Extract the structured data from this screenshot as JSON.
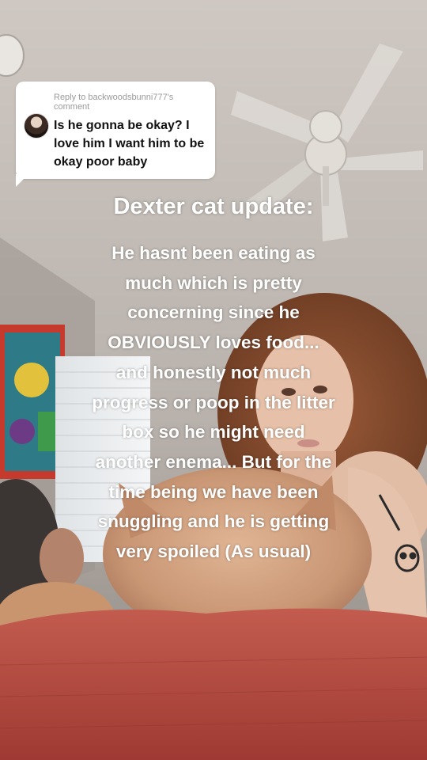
{
  "reply": {
    "meta": "Reply to backwoodsbunni777's comment",
    "comment": "Is he gonna be okay? I love him I want him to be okay poor baby"
  },
  "title": "Dexter cat update:",
  "body": "He hasnt been eating as\nmuch which is pretty\nconcerning since he\nOBVIOUSLY loves food...\nand honestly not much\nprogress or poop in the litter\nbox so he might need\nanother enema... But for the\ntime being we have been\nsnuggling and he is getting\nvery spoiled (As usual)"
}
